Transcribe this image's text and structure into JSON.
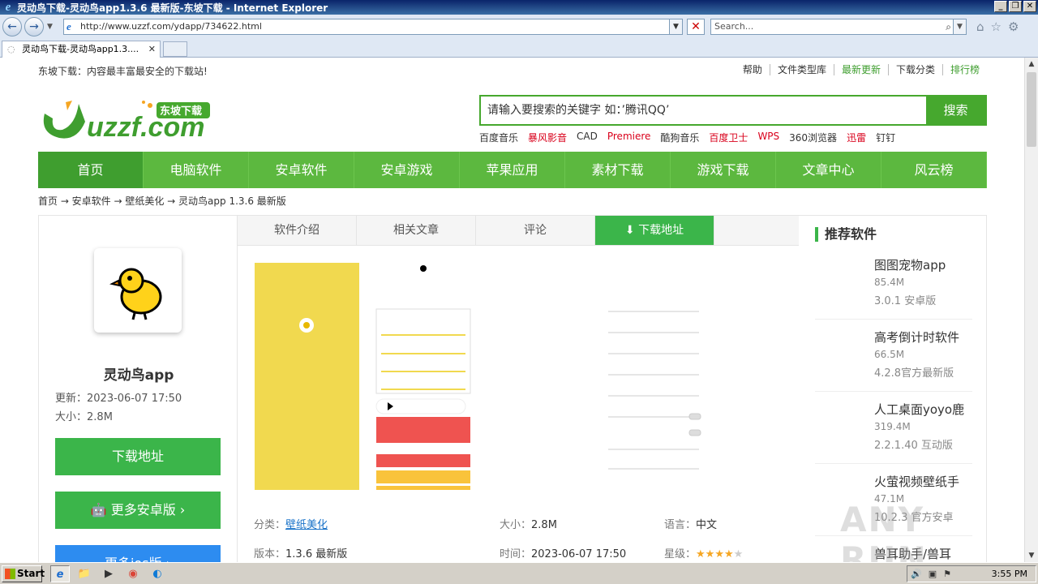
{
  "window": {
    "title": "灵动鸟下载-灵动鸟app1.3.6 最新版-东坡下载 - Internet Explorer"
  },
  "browser": {
    "url": "http://www.uzzf.com/ydapp/734622.html",
    "search_placeholder": "Search...",
    "tab_title": "灵动鸟下载-灵动鸟app1.3...."
  },
  "site": {
    "slogan": "东坡下载：内容最丰富最安全的下载站!",
    "top_links": [
      "帮助",
      "文件类型库",
      "最新更新",
      "下载分类",
      "排行榜"
    ],
    "logo_text": "uzzf.com",
    "logo_badge": "东坡下载",
    "search_placeholder": "请输入要搜索的关键字 如：’腾讯QQ’",
    "search_button": "搜索",
    "hotwords": [
      {
        "text": "百度音乐",
        "red": false
      },
      {
        "text": "暴风影音",
        "red": true
      },
      {
        "text": "CAD",
        "red": false
      },
      {
        "text": "Premiere",
        "red": true
      },
      {
        "text": "酷狗音乐",
        "red": false
      },
      {
        "text": "百度卫士",
        "red": true
      },
      {
        "text": "WPS",
        "red": true
      },
      {
        "text": "360浏览器",
        "red": false
      },
      {
        "text": "迅雷",
        "red": true
      },
      {
        "text": "钉钉",
        "red": false
      }
    ],
    "nav": [
      "首页",
      "电脑软件",
      "安卓软件",
      "安卓游戏",
      "苹果应用",
      "素材下载",
      "游戏下载",
      "文章中心",
      "风云榜"
    ],
    "breadcrumb": "首页 → 安卓软件 → 壁纸美化 → 灵动鸟app 1.3.6 最新版"
  },
  "app": {
    "name": "灵动鸟app",
    "updated_label": "更新：",
    "updated": "2023-06-07 17:50",
    "size_label": "大小：",
    "size": "2.8M",
    "download_btn": "下载地址",
    "more_android_btn": "更多安卓版",
    "more_ios_btn": "更多ios版"
  },
  "content": {
    "tabs": [
      "软件介绍",
      "相关文章",
      "评论",
      "下载地址"
    ],
    "info": {
      "category_label": "分类：",
      "category": "壁纸美化",
      "size_label": "大小：",
      "size": "2.8M",
      "lang_label": "语言：",
      "lang": "中文",
      "version_label": "版本：",
      "version": "1.3.6 最新版",
      "time_label": "时间：",
      "time": "2023-06-07 17:50",
      "rating_label": "星级：",
      "rating": 4,
      "rating_max": 5
    }
  },
  "sidebar": {
    "title": "推荐软件",
    "items": [
      {
        "name": "图图宠物app",
        "size": "85.4M",
        "ver": "3.0.1 安卓版"
      },
      {
        "name": "高考倒计时软件",
        "size": "66.5M",
        "ver": "4.2.8官方最新版"
      },
      {
        "name": "人工桌面yoyo鹿",
        "size": "319.4M",
        "ver": "2.2.1.40 互动版"
      },
      {
        "name": "火萤视频壁纸手",
        "size": "47.1M",
        "ver": "10.2.3 官方安卓"
      },
      {
        "name": "兽耳助手/兽耳",
        "size": "",
        "ver": ""
      }
    ]
  },
  "taskbar": {
    "start": "Start",
    "time": "3:55 PM"
  },
  "watermark": "ANY RUN",
  "colors": {
    "brand_green": "#46a82e",
    "nav_green": "#5cb83f",
    "button_blue": "#2d8cf0",
    "hot_red": "#d9001b"
  }
}
